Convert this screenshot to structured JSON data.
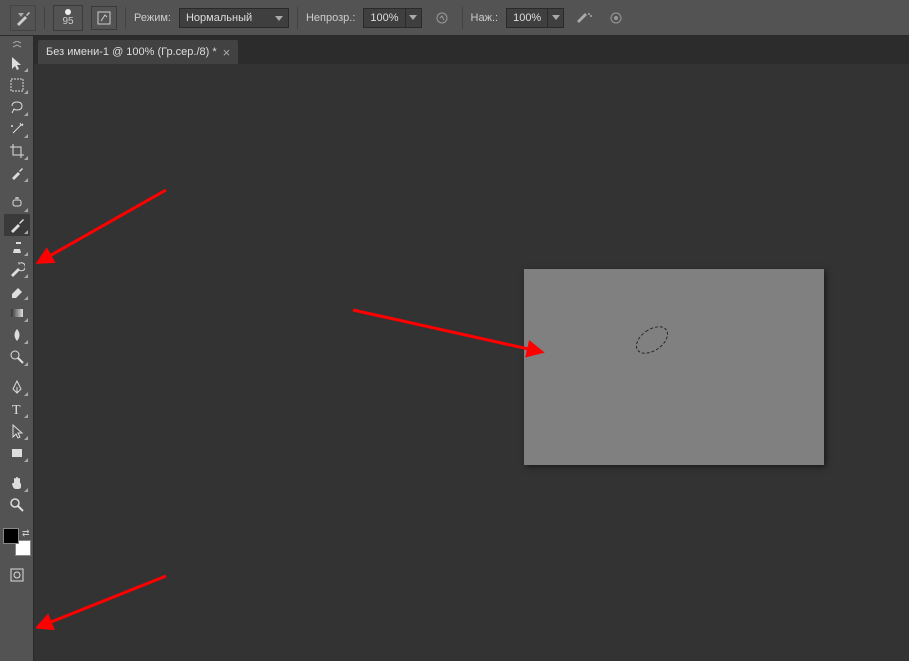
{
  "options": {
    "brush_size": "95",
    "mode_label": "Режим:",
    "mode_value": "Нормальный",
    "opacity_label": "Непрозр.:",
    "opacity_value": "100%",
    "flow_label": "Наж.:",
    "flow_value": "100%"
  },
  "tab": {
    "title": "Без имени-1 @ 100% (Гр.сер./8) *",
    "close": "×"
  },
  "tools": [
    {
      "name": "move-tool"
    },
    {
      "name": "marquee-tool"
    },
    {
      "name": "lasso-tool"
    },
    {
      "name": "magic-wand-tool"
    },
    {
      "name": "crop-tool"
    },
    {
      "name": "eyedropper-tool"
    },
    {
      "name": "healing-brush-tool"
    },
    {
      "name": "brush-tool",
      "active": true
    },
    {
      "name": "clone-stamp-tool"
    },
    {
      "name": "history-brush-tool"
    },
    {
      "name": "eraser-tool"
    },
    {
      "name": "gradient-tool"
    },
    {
      "name": "blur-tool"
    },
    {
      "name": "dodge-tool"
    },
    {
      "name": "pen-tool"
    },
    {
      "name": "type-tool"
    },
    {
      "name": "path-selection-tool"
    },
    {
      "name": "rectangle-tool"
    },
    {
      "name": "hand-tool"
    },
    {
      "name": "zoom-tool"
    }
  ]
}
